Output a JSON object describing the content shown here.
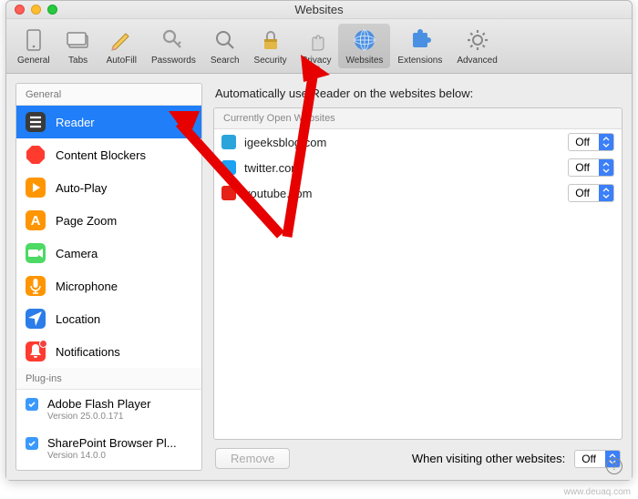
{
  "window_title": "Websites",
  "toolbar": [
    {
      "label": "General",
      "icon": "switch",
      "sel": false
    },
    {
      "label": "Tabs",
      "icon": "tab",
      "sel": false
    },
    {
      "label": "AutoFill",
      "icon": "pencil",
      "sel": false
    },
    {
      "label": "Passwords",
      "icon": "key",
      "sel": false
    },
    {
      "label": "Search",
      "icon": "search",
      "sel": false
    },
    {
      "label": "Security",
      "icon": "lock",
      "sel": false
    },
    {
      "label": "Privacy",
      "icon": "hand",
      "sel": false
    },
    {
      "label": "Websites",
      "icon": "globe",
      "sel": true
    },
    {
      "label": "Extensions",
      "icon": "puzzle",
      "sel": false
    },
    {
      "label": "Advanced",
      "icon": "gear",
      "sel": false
    }
  ],
  "sidebar": {
    "section1_title": "General",
    "items": [
      {
        "label": "Reader",
        "icon": "reader",
        "sel": true
      },
      {
        "label": "Content Blockers",
        "icon": "blocker",
        "sel": false
      },
      {
        "label": "Auto-Play",
        "icon": "play",
        "sel": false
      },
      {
        "label": "Page Zoom",
        "icon": "zoom",
        "sel": false
      },
      {
        "label": "Camera",
        "icon": "camera",
        "sel": false
      },
      {
        "label": "Microphone",
        "icon": "mic",
        "sel": false
      },
      {
        "label": "Location",
        "icon": "loc",
        "sel": false
      },
      {
        "label": "Notifications",
        "icon": "bell",
        "sel": false,
        "badge": true
      }
    ],
    "section2_title": "Plug-ins",
    "plugins": [
      {
        "label": "Adobe Flash Player",
        "sub": "Version 25.0.0.171",
        "checked": true
      },
      {
        "label": "SharePoint Browser Pl...",
        "sub": "Version 14.0.0",
        "checked": true
      }
    ]
  },
  "main": {
    "heading": "Automatically use Reader on the websites below:",
    "list_header": "Currently Open Websites",
    "rows": [
      {
        "site": "igeeksblog.com",
        "value": "Off",
        "fav": "#2aa4db"
      },
      {
        "site": "twitter.com",
        "value": "Off",
        "fav": "#1da1f2"
      },
      {
        "site": "youtube.com",
        "value": "Off",
        "fav": "#e62117"
      }
    ],
    "remove_label": "Remove",
    "footer_label": "When visiting other websites:",
    "footer_value": "Off"
  },
  "watermark": "www.deuaq.com"
}
